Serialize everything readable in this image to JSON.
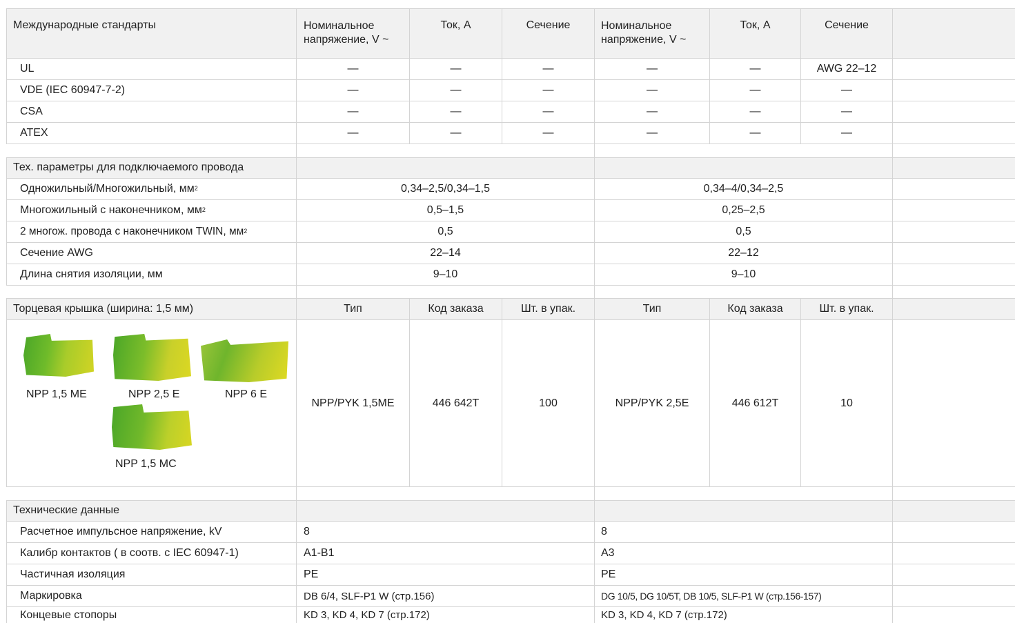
{
  "standards": {
    "header": {
      "title": "Международные стандарты",
      "g1": {
        "voltage": "Номинальное напряжение, V ~",
        "current": "Ток, A",
        "section": "Сечение"
      },
      "g2": {
        "voltage": "Номинальное напряжение, V ~",
        "current": "Ток, A",
        "section": "Сечение"
      }
    },
    "rows": [
      {
        "name": "UL",
        "v1": "—",
        "c1": "—",
        "s1": "—",
        "v2": "—",
        "c2": "—",
        "s2": "AWG 22–12"
      },
      {
        "name": "VDE (IEC 60947-7-2)",
        "v1": "—",
        "c1": "—",
        "s1": "—",
        "v2": "—",
        "c2": "—",
        "s2": "—"
      },
      {
        "name": "CSA",
        "v1": "—",
        "c1": "—",
        "s1": "—",
        "v2": "—",
        "c2": "—",
        "s2": "—"
      },
      {
        "name": "ATEX",
        "v1": "—",
        "c1": "—",
        "s1": "—",
        "v2": "—",
        "c2": "—",
        "s2": "—"
      }
    ]
  },
  "wire": {
    "title": "Тех. параметры для подключаемого провода",
    "rows": [
      {
        "name": "Одножильный/Многожильный, мм",
        "sup": "2",
        "v1": "0,34–2,5/0,34–1,5",
        "v2": "0,34–4/0,34–2,5"
      },
      {
        "name": "Многожильный с наконечником, мм",
        "sup": "2",
        "v1": "0,5–1,5",
        "v2": "0,25–2,5"
      },
      {
        "name": "2 многож. провода с наконечником TWIN, мм",
        "sup": "2",
        "v1": "0,5",
        "v2": "0,5"
      },
      {
        "name": "Сечение AWG",
        "sup": "",
        "v1": "22–14",
        "v2": "22–12"
      },
      {
        "name": "Длина снятия изоляции, мм",
        "sup": "",
        "v1": "9–10",
        "v2": "9–10"
      }
    ]
  },
  "endcap": {
    "title": "Торцевая крышка (ширина: 1,5 мм)",
    "g1": {
      "type": "Тип",
      "code": "Код заказа",
      "qty": "Шт. в упак."
    },
    "g2": {
      "type": "Тип",
      "code": "Код заказа",
      "qty": "Шт. в упак."
    },
    "products": [
      "NPP 1,5 ME",
      "NPP 2,5 E",
      "NPP 6 E",
      "NPP 1,5 MC"
    ],
    "item1": {
      "type": "NPP/PYK 1,5ME",
      "code": "446 642T",
      "qty": "100"
    },
    "item2": {
      "type": "NPP/PYK 2,5E",
      "code": "446 612T",
      "qty": "10"
    }
  },
  "tech": {
    "title": "Технические данные",
    "rows": [
      {
        "name": "Расчетное импульсное напряжение, kV",
        "v1": "8",
        "v2": "8"
      },
      {
        "name": "Калибр контактов ( в соотв. с IEC 60947-1)",
        "v1": "A1-B1",
        "v2": "A3"
      },
      {
        "name": "Частичная изоляция",
        "v1": "PE",
        "v2": "PE"
      },
      {
        "name": "Маркировка",
        "v1": "DB 6/4, SLF-P1 W (стр.156)",
        "v2": "DG 10/5, DG 10/5T, DB 10/5, SLF-P1 W (стр.156-157)"
      },
      {
        "name": "Концевые стопоры",
        "v1": "KD 3, KD 4, KD 7 (стр.172)",
        "v2": "KD 3, KD 4, KD 7 (стр.172)"
      }
    ]
  },
  "colors": {
    "header_bg": "#f1f1f1",
    "grid": "#d4d4d4",
    "cap_green": "#5cae22",
    "cap_yellow": "#d9d91a"
  }
}
